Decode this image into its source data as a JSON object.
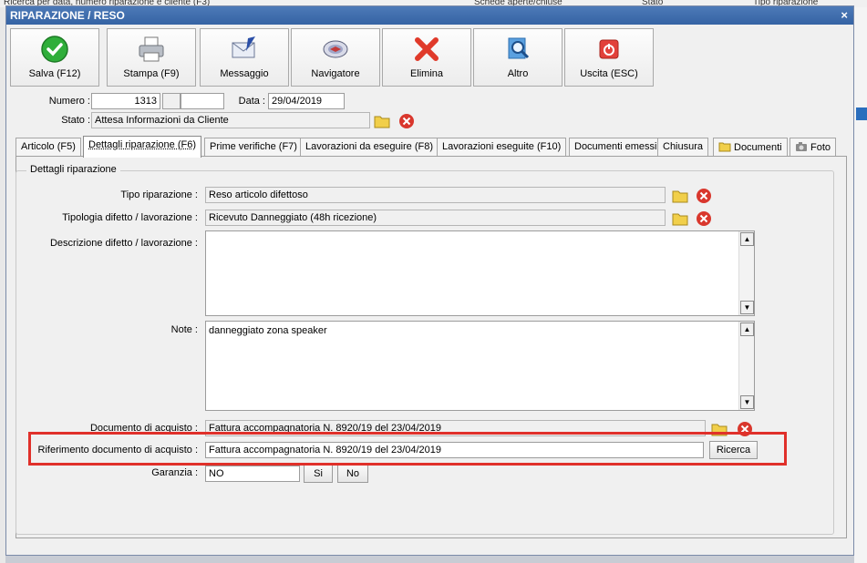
{
  "background": {
    "strip_left": "Ricerca per data, numero riparazione e cliente (F3)",
    "strip_mid": "Schede aperte/chiuse",
    "strip_mid2": "Stato",
    "strip_right": "Tipo riparazione"
  },
  "window": {
    "title": "RIPARAZIONE / RESO",
    "close": "×"
  },
  "toolbar": {
    "save": "Salva (F12)",
    "print": "Stampa (F9)",
    "message": "Messaggio",
    "navigator": "Navigatore",
    "delete": "Elimina",
    "other": "Altro",
    "exit": "Uscita (ESC)"
  },
  "header": {
    "numero_label": "Numero :",
    "numero_value": "1313",
    "data_label": "Data :",
    "data_value": "29/04/2019",
    "stato_label": "Stato :",
    "stato_value": "Attesa Informazioni da Cliente"
  },
  "tabs": [
    "Articolo (F5)",
    "Dettagli riparazione (F6)",
    "Prime verifiche (F7)",
    "Lavorazioni da eseguire (F8)",
    "Lavorazioni eseguite  (F10)",
    "Documenti emessi",
    "Chiusura",
    "Documenti",
    "Foto"
  ],
  "details": {
    "group_title": "Dettagli riparazione",
    "tipo_label": "Tipo riparazione :",
    "tipo_value": "Reso articolo difettoso",
    "tipologia_label": "Tipologia difetto / lavorazione :",
    "tipologia_value": "Ricevuto Danneggiato (48h ricezione)",
    "descrizione_label": "Descrizione difetto / lavorazione :",
    "descrizione_value": "",
    "note_label": "Note :",
    "note_value": "danneggiato zona speaker",
    "documento_label": "Documento di acquisto :",
    "documento_value": "Fattura accompagnatoria N. 8920/19 del 23/04/2019",
    "riferimento_label": "Riferimento documento di acquisto :",
    "riferimento_value": "Fattura accompagnatoria N. 8920/19 del 23/04/2019",
    "ricerca_button": "Ricerca",
    "garanzia_label": "Garanzia :",
    "garanzia_value": "NO",
    "si_button": "Si",
    "no_button": "No"
  },
  "colors": {
    "titlebar": "#3c6aa9",
    "highlight": "#e0302a"
  }
}
